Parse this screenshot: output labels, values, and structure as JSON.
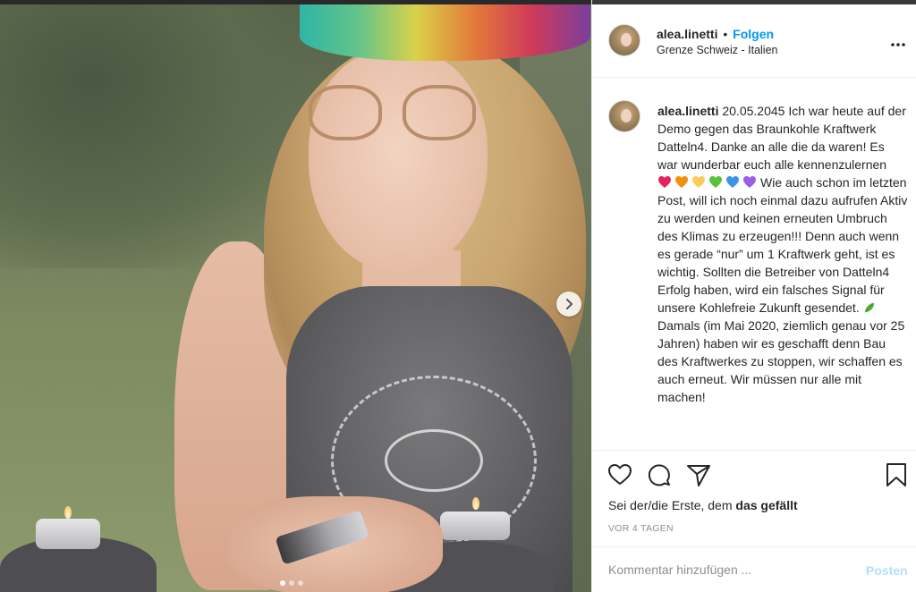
{
  "post": {
    "username": "alea.linetti",
    "separator": "•",
    "follow_label": "Folgen",
    "location": "Grenze Schweiz - Italien"
  },
  "caption": {
    "username": "alea.linetti",
    "date": "20.05.2045",
    "text_part1": "Ich war heute auf der Demo gegen das Braunkohle Kraftwerk Datteln4. Danke an alle die da waren! Es war wunderbar euch alle kennenzulernen",
    "hearts": [
      "red-heart",
      "orange-heart",
      "yellow-heart",
      "green-heart",
      "blue-heart",
      "purple-heart"
    ],
    "heart_colors": [
      "#e0245e",
      "#f4900c",
      "#fdcb58",
      "#57c23a",
      "#3b94e8",
      "#9b5de5"
    ],
    "text_part2": "Wie auch schon im letzten Post, will ich noch einmal dazu aufrufen Aktiv zu werden und keinen erneuten Umbruch des Klimas zu erzeugen!!! Denn auch wenn es gerade “nur” um 1 Kraftwerk geht, ist es wichtig. Sollten die Betreiber von Datteln4 Erfolg haben, wird ein falsches Signal für unsere Kohlefreie Zukunft gesendet.",
    "leaf_icon": "leaf-icon",
    "text_part3": "Damals (im Mai 2020, ziemlich genau vor 25 Jahren) haben wir es geschafft denn Bau des Kraftwerkes zu stoppen, wir schaffen es auch erneut. Wir müssen nur alle mit machen!"
  },
  "likes": {
    "prefix": "Sei der/die Erste, dem ",
    "bold": "das gefällt"
  },
  "time_ago": "VOR 4 TAGEN",
  "comment_box": {
    "placeholder": "Kommentar hinzufügen ...",
    "post_label": "Posten"
  },
  "carousel": {
    "total": 3,
    "current": 1
  },
  "colors": {
    "accent": "#0095f6",
    "post_disabled": "#b2dffc",
    "muted": "#8e8e8e"
  }
}
